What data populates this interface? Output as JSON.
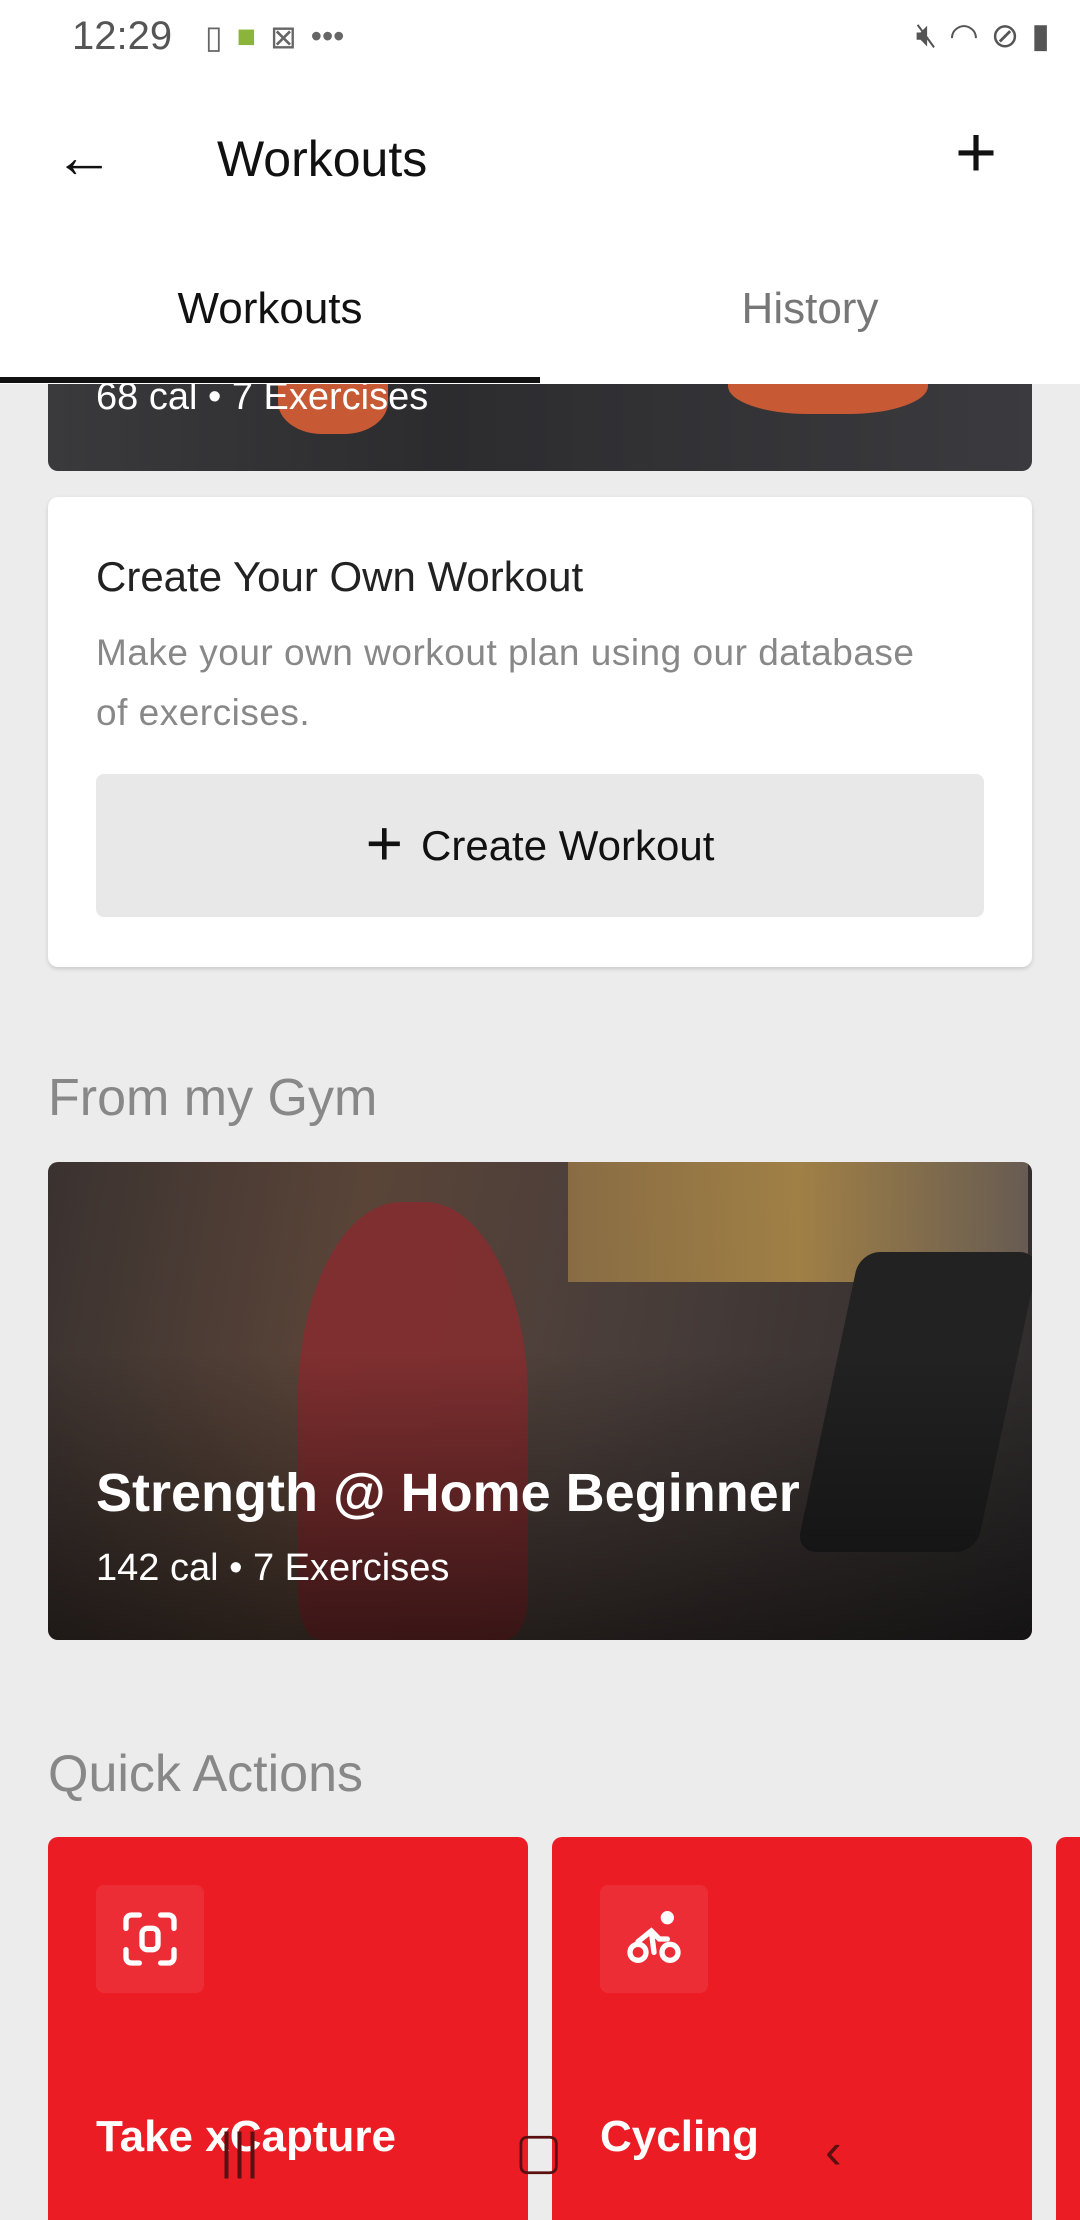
{
  "status_bar": {
    "time": "12:29",
    "left_icons": [
      "checklist-phone-icon",
      "android-icon",
      "sim-dollar-icon",
      "more-dots-icon"
    ],
    "right_icons": [
      "mute-icon",
      "wifi-icon",
      "do-not-disturb-icon",
      "battery-icon"
    ],
    "more": "•••"
  },
  "header": {
    "title": "Workouts"
  },
  "tabs": [
    {
      "label": "Workouts",
      "active": true
    },
    {
      "label": "History",
      "active": false
    }
  ],
  "top_card": {
    "meta": "68 cal • 7 Exercises"
  },
  "create_card": {
    "title": "Create Your Own Workout",
    "description": "Make your own workout plan using our database of exercises.",
    "button_label": "Create Workout"
  },
  "gym_section": {
    "heading": "From my Gym",
    "workout": {
      "title": "Strength @ Home Beginner",
      "meta": "142 cal • 7 Exercises"
    }
  },
  "quick_actions": {
    "heading": "Quick Actions",
    "items": [
      {
        "label": "Take xCapture",
        "icon": "scan-icon"
      },
      {
        "label": "Cycling",
        "icon": "cycling-icon"
      }
    ]
  },
  "colors": {
    "accent": "#ec1c24",
    "background": "#ececec"
  }
}
